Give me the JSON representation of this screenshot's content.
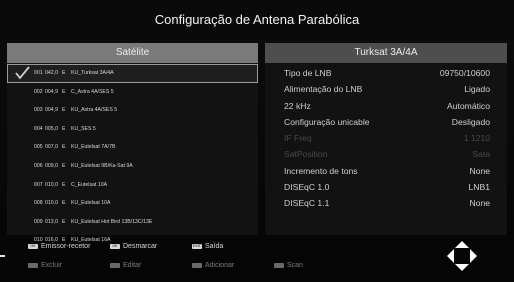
{
  "header": {
    "title": "Configuração de Antena Parabólica"
  },
  "left_panel": {
    "title": "Satélite",
    "rows": [
      {
        "num": "001",
        "deg": "042,0",
        "dir": "E",
        "name": "KU_Turksat 3A/4A",
        "selected": true
      },
      {
        "num": "002",
        "deg": "004,9",
        "dir": "E",
        "name": "C_Astra 4A/SES 5",
        "selected": false
      },
      {
        "num": "003",
        "deg": "004,9",
        "dir": "E",
        "name": "KU_Astra 4A/SES 5",
        "selected": false
      },
      {
        "num": "004",
        "deg": "005,0",
        "dir": "E",
        "name": "KU_SES 5",
        "selected": false
      },
      {
        "num": "005",
        "deg": "007,0",
        "dir": "E",
        "name": "KU_Eutelsat 7A/7B",
        "selected": false
      },
      {
        "num": "006",
        "deg": "009,0",
        "dir": "E",
        "name": "KU_Eutelsat 9B/Ka-Sat 9A",
        "selected": false
      },
      {
        "num": "007",
        "deg": "010,0",
        "dir": "E",
        "name": "C_Eutelsat 10A",
        "selected": false
      },
      {
        "num": "008",
        "deg": "010,0",
        "dir": "E",
        "name": "KU_Eutelsat 10A",
        "selected": false
      },
      {
        "num": "009",
        "deg": "013,0",
        "dir": "E",
        "name": "KU_Eutelsat Hot Bird 13B/13C/13E",
        "selected": false
      },
      {
        "num": "010",
        "deg": "016,0",
        "dir": "E",
        "name": "KU_Eutelsat 16A",
        "selected": false
      }
    ]
  },
  "right_panel": {
    "title": "Turksat 3A/4A",
    "properties": [
      {
        "label": "Tipo de LNB",
        "value": "09750/10600",
        "enabled": true
      },
      {
        "label": "Alimentação do LNB",
        "value": "Ligado",
        "enabled": true
      },
      {
        "label": "22 kHz",
        "value": "Automático",
        "enabled": true
      },
      {
        "label": "Configuração unicable",
        "value": "Desligado",
        "enabled": true
      },
      {
        "label": "IF Freq",
        "value": "1 1210",
        "enabled": false
      },
      {
        "label": "SatPosition",
        "value": "Sata",
        "enabled": false
      },
      {
        "label": "Incremento de tons",
        "value": "None",
        "enabled": true
      },
      {
        "label": "DISEqC 1.0",
        "value": "LNB1",
        "enabled": true
      },
      {
        "label": "DISEqC 1.1",
        "value": "None",
        "enabled": true
      }
    ]
  },
  "legend": {
    "row1": [
      {
        "key": "OK",
        "label": "Emissor-recetor"
      },
      {
        "key": "OK",
        "label": "Desmarcar"
      },
      {
        "key": "EXIT",
        "label": "Saída"
      }
    ],
    "row2": [
      {
        "label": "Excluir"
      },
      {
        "label": "Editar"
      },
      {
        "label": "Adicionar"
      },
      {
        "label": "Scan"
      }
    ]
  },
  "colors": {
    "background": "#000000",
    "left_header": "#7a7a7a",
    "right_header": "#4e4e4e",
    "panel": "#121212"
  },
  "icons": [
    "check-icon",
    "navigation-arrows-icon"
  ]
}
